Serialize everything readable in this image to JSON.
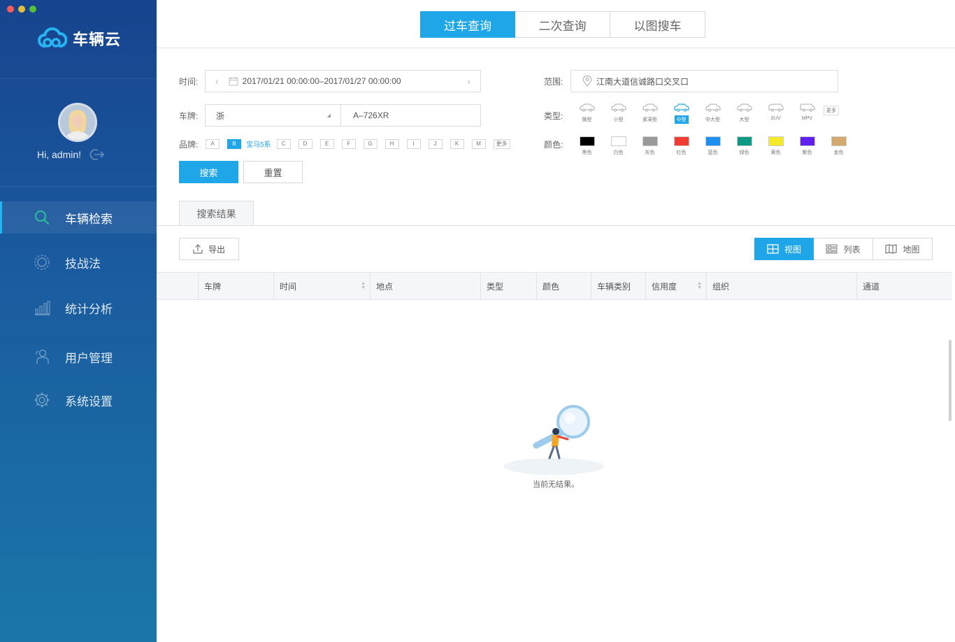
{
  "app": {
    "name": "车辆云"
  },
  "user": {
    "greeting": "Hi, admin!"
  },
  "nav": [
    {
      "label": "车辆检索",
      "icon": "search-icon",
      "active": true
    },
    {
      "label": "技战法",
      "icon": "target-icon",
      "active": false
    },
    {
      "label": "统计分析",
      "icon": "bar-chart-icon",
      "active": false
    },
    {
      "label": "用户管理",
      "icon": "users-icon",
      "active": false
    },
    {
      "label": "系统设置",
      "icon": "gear-icon",
      "active": false
    }
  ],
  "tabs": [
    {
      "label": "过车查询",
      "active": true
    },
    {
      "label": "二次查询",
      "active": false
    },
    {
      "label": "以图搜车",
      "active": false
    }
  ],
  "form": {
    "time_label": "时间:",
    "time_value": "2017/01/21 00:00:00–2017/01/27 00:00:00",
    "plate_label": "车牌:",
    "plate_province": "浙",
    "plate_number": "A–726XR",
    "brand_label": "品牌:",
    "brand_letters": [
      "A",
      "B"
    ],
    "brand_selected": "宝马5系",
    "brand_letters_rest": [
      "C",
      "D",
      "E",
      "F",
      "G",
      "H",
      "I",
      "J",
      "K",
      "M"
    ],
    "brand_more": "更多",
    "range_label": "范围:",
    "range_value": "江南大道信诚路口交叉口",
    "type_label": "类型:",
    "types": [
      "微型",
      "小型",
      "紧凑型",
      "中型",
      "中大型",
      "大型",
      "SUV",
      "MPV"
    ],
    "type_more": "更多",
    "color_label": "颜色:",
    "colors": [
      {
        "name": "黑色",
        "hex": "#000000"
      },
      {
        "name": "白色",
        "hex": "#ffffff"
      },
      {
        "name": "灰色",
        "hex": "#999999"
      },
      {
        "name": "红色",
        "hex": "#f03c32"
      },
      {
        "name": "蓝色",
        "hex": "#1e8ef0"
      },
      {
        "name": "绿色",
        "hex": "#0c9a84"
      },
      {
        "name": "黄色",
        "hex": "#f5ea2a"
      },
      {
        "name": "紫色",
        "hex": "#6020f0"
      },
      {
        "name": "金色",
        "hex": "#d2aa6e"
      }
    ],
    "search_btn": "搜索",
    "reset_btn": "重置"
  },
  "results": {
    "tab_label": "搜索结果",
    "export_btn": "导出",
    "views": [
      {
        "label": "视图",
        "active": true
      },
      {
        "label": "列表",
        "active": false
      },
      {
        "label": "地图",
        "active": false
      }
    ],
    "columns": [
      "车牌",
      "时间",
      "地点",
      "类型",
      "颜色",
      "车辆类别",
      "信用度",
      "组织",
      "通道"
    ],
    "empty_text": "当前无结果。"
  },
  "colors": {
    "accent": "#1fa6e8",
    "sidebar_top": "#17448e",
    "sidebar_bottom": "#1a77a8"
  }
}
